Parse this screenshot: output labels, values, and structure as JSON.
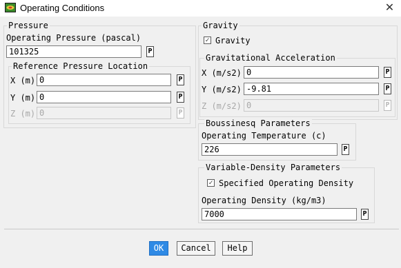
{
  "window": {
    "title": "Operating Conditions",
    "close_symbol": "✕"
  },
  "pressure": {
    "legend": "Pressure",
    "operating_label": "Operating Pressure (pascal)",
    "operating_value": "101325",
    "ref_legend": "Reference Pressure Location",
    "x_label": "X (m)",
    "x_value": "0",
    "y_label": "Y (m)",
    "y_value": "0",
    "z_label": "Z (m)",
    "z_value": "0"
  },
  "gravity": {
    "legend": "Gravity",
    "checkbox_label": "Gravity",
    "checked": true,
    "accel_legend": "Gravitational Acceleration",
    "x_label": "X (m/s2)",
    "x_value": "0",
    "y_label": "Y (m/s2)",
    "y_value": "-9.81",
    "z_label": "Z (m/s2)",
    "z_value": "0"
  },
  "boussinesq": {
    "legend": "Boussinesq Parameters",
    "temp_label": "Operating Temperature (c)",
    "temp_value": "226"
  },
  "variable_density": {
    "legend": "Variable-Density Parameters",
    "checkbox_label": "Specified Operating Density",
    "checked": true,
    "density_label": "Operating Density (kg/m3)",
    "density_value": "7000"
  },
  "param_button_label": "P",
  "buttons": {
    "ok": "OK",
    "cancel": "Cancel",
    "help": "Help"
  },
  "colors": {
    "primary": "#2f8ae5",
    "background": "#f0f0f0"
  }
}
